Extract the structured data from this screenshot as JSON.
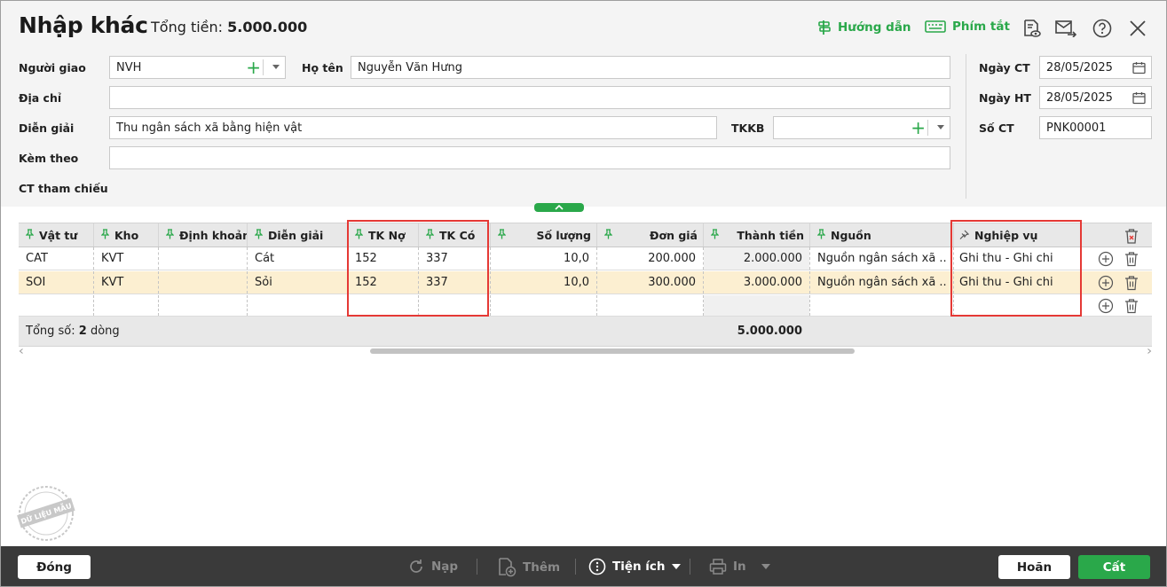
{
  "header": {
    "title": "Nhập khác",
    "total_label": "Tổng tiền:",
    "total_value": "5.000.000",
    "guide_label": "Hướng dẫn",
    "shortcut_label": "Phím tắt"
  },
  "form": {
    "nguoi_giao_label": "Người giao",
    "nguoi_giao_value": "NVH",
    "ho_ten_label": "Họ tên",
    "ho_ten_value": "Nguyễn Văn Hưng",
    "dia_chi_label": "Địa chỉ",
    "dia_chi_value": "",
    "dien_giai_label": "Diễn giải",
    "dien_giai_value": "Thu ngân sách xã bằng hiện vật",
    "tkkb_label": "TKKB",
    "tkkb_value": "",
    "kem_theo_label": "Kèm theo",
    "kem_theo_value": "",
    "ct_tham_chieu_label": "CT tham chiếu",
    "ngay_ct_label": "Ngày CT",
    "ngay_ct_value": "28/05/2025",
    "ngay_ht_label": "Ngày HT",
    "ngay_ht_value": "28/05/2025",
    "so_ct_label": "Số CT",
    "so_ct_value": "PNK00001"
  },
  "grid": {
    "columns": [
      "Vật tư",
      "Kho",
      "Định khoản",
      "Diễn giải",
      "TK Nợ",
      "TK Có",
      "Số lượng",
      "Đơn giá",
      "Thành tiền",
      "Nguồn",
      "Nghiệp vụ"
    ],
    "rows": [
      {
        "vat_tu": "CAT",
        "kho": "KVT",
        "dinh_khoan": "",
        "dien_giai": "Cát",
        "tk_no": "152",
        "tk_co": "337",
        "so_luong": "10,0",
        "don_gia": "200.000",
        "thanh_tien": "2.000.000",
        "nguon": "Nguồn ngân sách xã ...",
        "nghiep_vu": "Ghi thu - Ghi chi"
      },
      {
        "vat_tu": "SOI",
        "kho": "KVT",
        "dinh_khoan": "",
        "dien_giai": "Sỏi",
        "tk_no": "152",
        "tk_co": "337",
        "so_luong": "10,0",
        "don_gia": "300.000",
        "thanh_tien": "3.000.000",
        "nguon": "Nguồn ngân sách xã ...",
        "nghiep_vu": "Ghi thu - Ghi chi"
      }
    ],
    "summary_label": "Tổng số:",
    "summary_count": "2",
    "summary_unit": "dòng",
    "summary_total": "5.000.000"
  },
  "watermark": "DỮ LIỆU MẪU",
  "footer": {
    "close_label": "Đóng",
    "reload_label": "Nạp",
    "add_label": "Thêm",
    "utility_label": "Tiện ích",
    "print_label": "In",
    "cancel_label": "Hoãn",
    "save_label": "Cất"
  },
  "colors": {
    "accent": "#2aa84a",
    "highlight_box": "#e53935",
    "selected_row": "#fcefd1",
    "footer_bg": "#3a3a3a"
  }
}
